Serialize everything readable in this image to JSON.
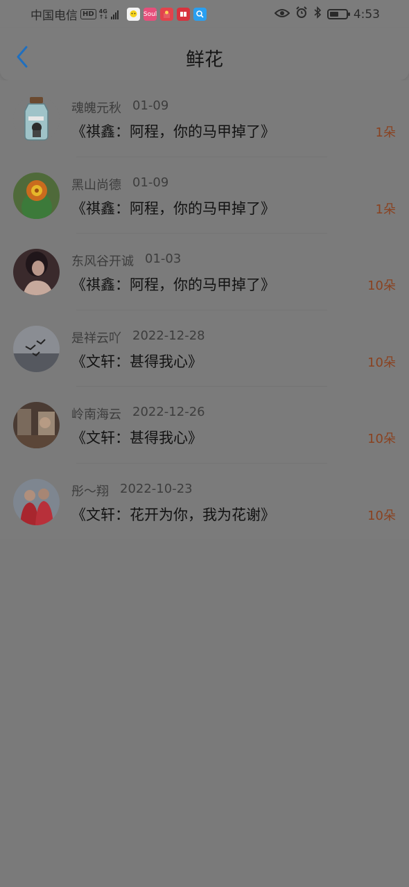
{
  "status_bar": {
    "carrier": "中国电信",
    "hd_label": "HD",
    "network": "4G",
    "time": "4:53",
    "app_icons": [
      "chat-bubble-icon",
      "soul-app-icon",
      "gift-app-icon",
      "reader-app-icon",
      "search-app-icon"
    ],
    "icons": [
      "eye-icon",
      "alarm-icon",
      "bluetooth-icon",
      "battery-icon"
    ]
  },
  "nav": {
    "title": "鲜花",
    "back_icon": "chevron-left-icon",
    "accent": "#1f6fbf"
  },
  "colors": {
    "flower_count": "#8a4220",
    "overlay_bg": "#7a7a7a"
  },
  "records": [
    {
      "name": "魂魄元秋",
      "date": "01-09",
      "song": "《祺鑫：阿程，你的马甲掉了》",
      "count": "1朵",
      "avatar": "jar-avatar"
    },
    {
      "name": "黑山尚德",
      "date": "01-09",
      "song": "《祺鑫：阿程，你的马甲掉了》",
      "count": "1朵",
      "avatar": "flower-avatar"
    },
    {
      "name": "东风谷开诚",
      "date": "01-03",
      "song": "《祺鑫：阿程，你的马甲掉了》",
      "count": "10朵",
      "avatar": "woman-avatar"
    },
    {
      "name": "是祥云吖",
      "date": "2022-12-28",
      "song": "《文轩：甚得我心》",
      "count": "10朵",
      "avatar": "birds-avatar"
    },
    {
      "name": "岭南海云",
      "date": "2022-12-26",
      "song": "《文轩：甚得我心》",
      "count": "10朵",
      "avatar": "room-avatar"
    },
    {
      "name": "彤～翔",
      "date": "2022-10-23",
      "song": "《文轩：花开为你，我为花谢》",
      "count": "10朵",
      "avatar": "couple-avatar"
    }
  ]
}
